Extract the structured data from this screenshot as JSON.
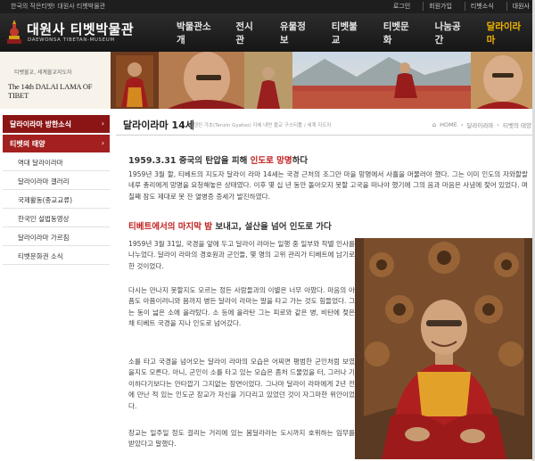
{
  "top_bar": {
    "slogan": "한국의 작은티벳! 대원사 티벳박물관",
    "links": [
      "로그인",
      "회원가입",
      "티벳소식",
      "대원사"
    ]
  },
  "header": {
    "logo_title": "대원사 티벳박물관",
    "logo_subtitle": "DAEWONSA TIBETAN-MUSEUM",
    "nav": [
      "박물관소개",
      "전시관",
      "유물정보",
      "티벳불교",
      "티벳문화",
      "나눔공간",
      "달라이라마"
    ],
    "active_nav": "달라이라마"
  },
  "banner": {
    "caption_small": "티벳불교, 세계불교지도자",
    "caption_big": "The 14th DALAI LAMA OF TIBET"
  },
  "sidebar": {
    "section_head": "달라이라마 방한소식",
    "sub_head": "티벳의 태양",
    "items": [
      "역대 달라이라마",
      "달라이라마 갤러리",
      "국제활동(종교교류)",
      "한국인 설법동영상",
      "달라이라마 가르침",
      "티벳문화권 소식"
    ]
  },
  "page": {
    "title": "달라이라마 14세",
    "subtitle": "텐진 갸초(Tenzin Gyatso) 지혜 내면 불교 구스티틀 / 세계 지도자",
    "breadcrumb": [
      "HOME",
      "달라이라마",
      "티벳의 태양"
    ]
  },
  "article": {
    "heading1_pre": "1959.3.31 중국의 탄압을 피해 ",
    "heading1_red": "인도로 망명",
    "heading1_post": "하다",
    "paragraph1": "1959년 3월 할, 티베트의 지도자 달라이 라마 14세는 국경 근처의 조그만 마을 망명에서 사흘을 머물러야 했다. 그는 이미 인도의 자와할랄 네루 총리에게 망명을 요청해놓은 상태였다. 이후 몇 십 년 동안 돌아오지 못할 고국을 떠나야 했기에 그의 음과 마음은 사념에 젖어 있었다. 며칠째 잠도 제대로 못 잔 열병증 증세가 발진하였다.",
    "heading2_red": "티베트에서의 마지막 밤",
    "heading2_post": " 보내고, 설산을 넘어 인도로 가다",
    "paragraph2": "1959년 3월 31일, 국경을 앞에 두고 달라이 라마는 일행 중 일부와 작별 인사를 나누었다. 달라이 라마의 경호원과 군인들, 몇 명의 고위 관리가 티베트에 남기로 한 것이었다.",
    "paragraph3": "다시는 만나지 못할지도 모르는 정든 사람들과의 이별은 너무 아팠다. 마음의 아픔도 아픔이려니와 몸까지 병든 달라이 라마는 말을 타고 가는 것도 힘들었다. 그는 동이 넓은 소에 올라탔다. 소 등에 올라탄 그는 피로와 같은 병, 비탄에 젖은 채 티베트 국경을 지나 인도로 넘어갔다.",
    "paragraph4": "소를 타고 국경을 넘어오는 달라이 라마의 모습은 어찌면 평범한 군인처럼 보였을지도 모른다. 아니, 군인이 소를 타고 있는 모습은 좀처 드물었을 터, 그러나 기이하다기보다는 안타깝기 그지없는 장면이었다. 그나마 달라이 라마에게 2년 전에 만난 적 있는 인도군 장교가 자신을 기다리고 있었던 것이 자그마한 위안이었다.",
    "paragraph5": "장교는 일주일 정도 걸리는 거리에 있는 봄딜라라는 도시까지 호위하는 임무를 받았다고 말했다."
  },
  "colors": {
    "accent_red": "#8b1515",
    "nav_active": "#f0b400",
    "header_bg": "#1e1e1e"
  },
  "icons": {
    "home": "home-icon",
    "breadcrumb_separator": "chevron-right-icon",
    "sidebar_arrow": "chevron-right-icon"
  }
}
